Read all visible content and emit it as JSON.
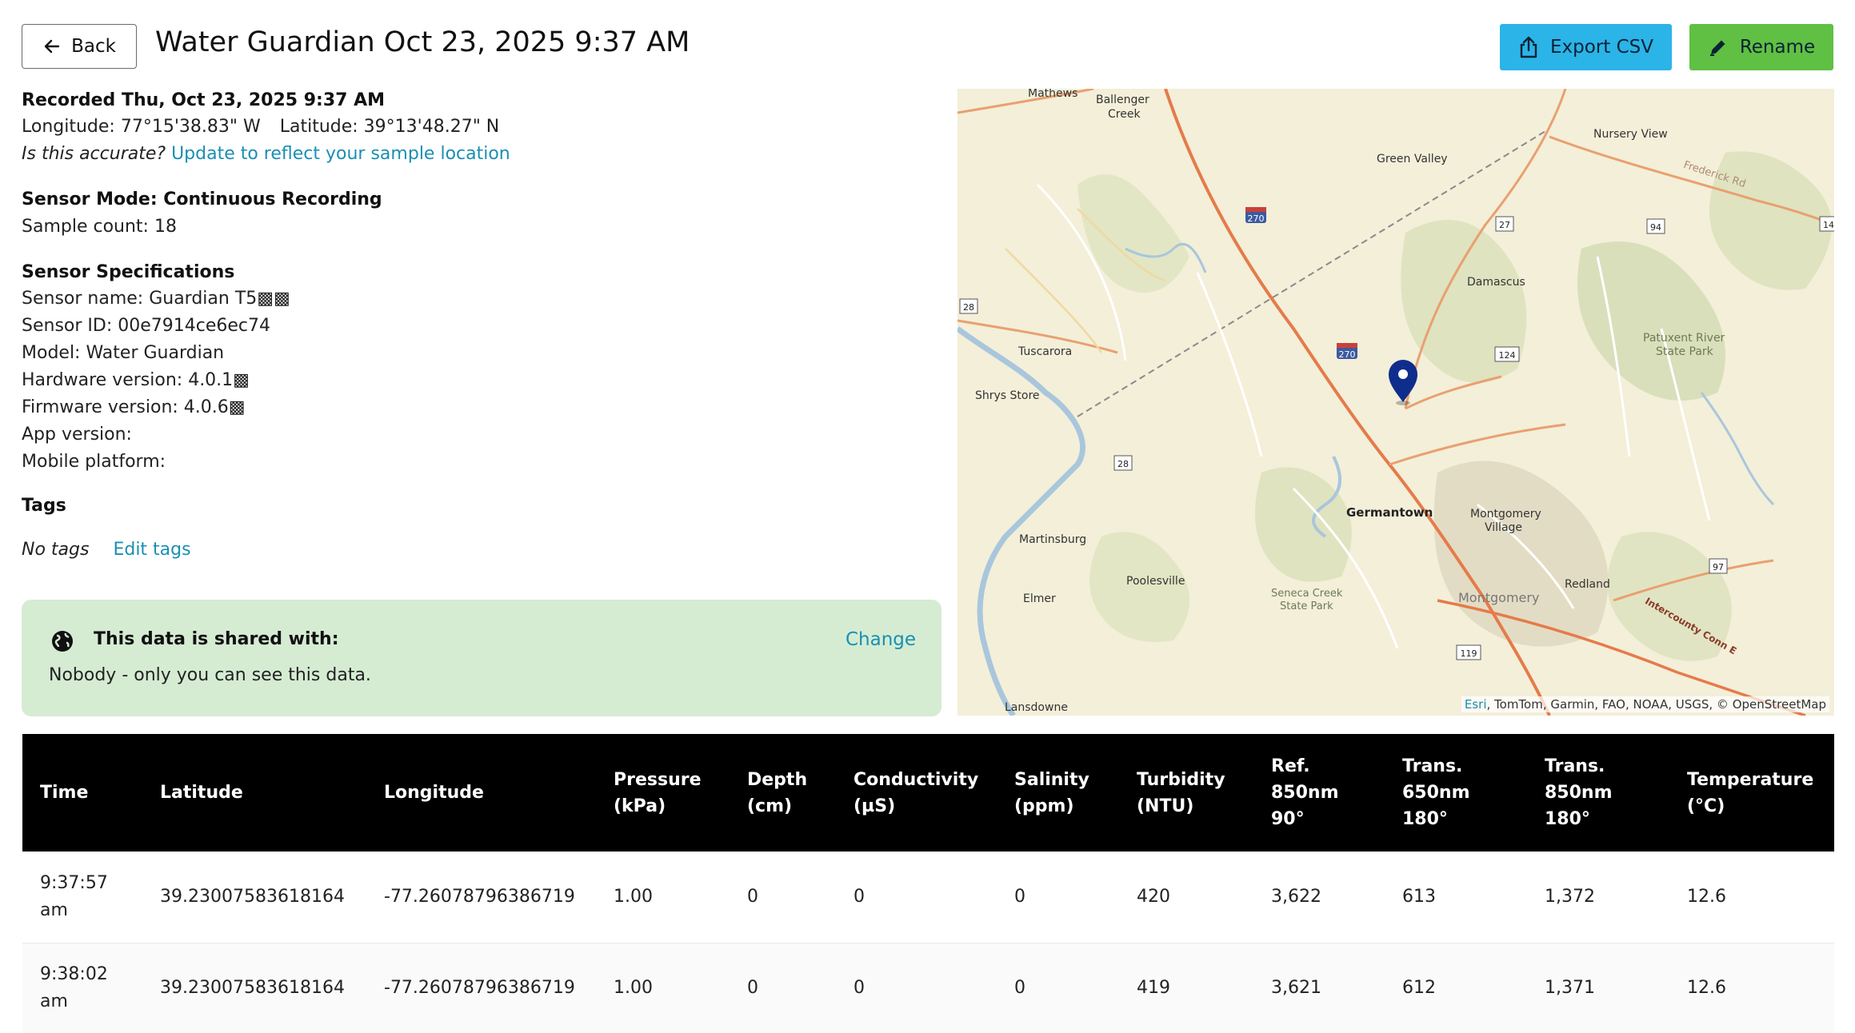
{
  "header": {
    "back_label": "Back",
    "title": "Water Guardian Oct 23, 2025 9:37 AM",
    "export_label": "Export CSV",
    "rename_label": "Rename"
  },
  "details": {
    "recorded": "Recorded Thu, Oct 23, 2025 9:37 AM",
    "longitude": "Longitude: 77°15'38.83\" W",
    "latitude": "Latitude: 39°13'48.27\" N",
    "accuracy_question": "Is this accurate?",
    "accuracy_link": "Update to reflect your sample location",
    "sensor_mode": "Sensor Mode: Continuous Recording",
    "sample_count": "Sample count: 18",
    "specs_heading": "Sensor Specifications",
    "sensor_name": "Sensor name: Guardian T5▩▩",
    "sensor_id": "Sensor ID: 00e7914ce6ec74",
    "model": "Model: Water Guardian",
    "hardware": "Hardware version: 4.0.1▩",
    "firmware": "Firmware version: 4.0.6▩",
    "app_version": "App version:",
    "mobile_platform": "Mobile platform:",
    "tags_heading": "Tags",
    "no_tags": "No tags",
    "edit_tags": "Edit tags"
  },
  "share": {
    "title": "This data is shared with:",
    "description": "Nobody - only you can see this data.",
    "change_label": "Change"
  },
  "map": {
    "attribution_link": "Esri",
    "attribution_rest": ", TomTom, Garmin, FAO, NOAA, USGS, © OpenStreetMap",
    "labels": {
      "mathews": "Mathews",
      "ballenger": "Ballenger",
      "creek": "Creek",
      "green_valley": "Green Valley",
      "nursery_view": "Nursery View",
      "frederick_rd": "Frederick Rd",
      "damascus": "Damascus",
      "tuscarora": "Tuscarora",
      "shrys_store": "Shrys Store",
      "patuxent": "Patuxent River",
      "state_park": "State Park",
      "germantown": "Germantown",
      "montgomery": "Montgomery",
      "village": "Village",
      "martinsburg": "Martinsburg",
      "poolesville": "Poolesville",
      "elmer": "Elmer",
      "seneca": "Seneca Creek",
      "seneca_park": "State Park",
      "montgomery2": "Montgomery",
      "redland": "Redland",
      "intercounty": "Intercounty Conn E",
      "lansdowne": "Lansdowne",
      "r270a": "270",
      "r270b": "270",
      "r27": "27",
      "r94": "94",
      "r28a": "28",
      "r28b": "28",
      "r124": "124",
      "r119": "119",
      "r97": "97",
      "r14": "14"
    }
  },
  "table": {
    "headers": [
      [
        "Time"
      ],
      [
        "Latitude"
      ],
      [
        "Longitude"
      ],
      [
        "Pressure",
        "(kPa)"
      ],
      [
        "Depth",
        "(cm)"
      ],
      [
        "Conductivity",
        "(µS)"
      ],
      [
        "Salinity",
        "(ppm)"
      ],
      [
        "Turbidity",
        "(NTU)"
      ],
      [
        "Ref.",
        "850nm",
        "90°"
      ],
      [
        "Trans.",
        "650nm",
        "180°"
      ],
      [
        "Trans.",
        "850nm",
        "180°"
      ],
      [
        "Temperature",
        "(°C)"
      ]
    ],
    "rows": [
      [
        [
          "9:37:57",
          "am"
        ],
        "39.23007583618164",
        "-77.26078796386719",
        "1.00",
        "0",
        "0",
        "0",
        "420",
        "3,622",
        "613",
        "1,372",
        "12.6"
      ],
      [
        [
          "9:38:02",
          "am"
        ],
        "39.23007583618164",
        "-77.26078796386719",
        "1.00",
        "0",
        "0",
        "0",
        "419",
        "3,621",
        "612",
        "1,371",
        "12.6"
      ]
    ]
  },
  "colors": {
    "export_button": "#2ab4e8",
    "rename_button": "#5fc043",
    "share_background": "#d5ecd3",
    "link": "#1a8fb3",
    "map_pin": "#0f2d8c"
  }
}
